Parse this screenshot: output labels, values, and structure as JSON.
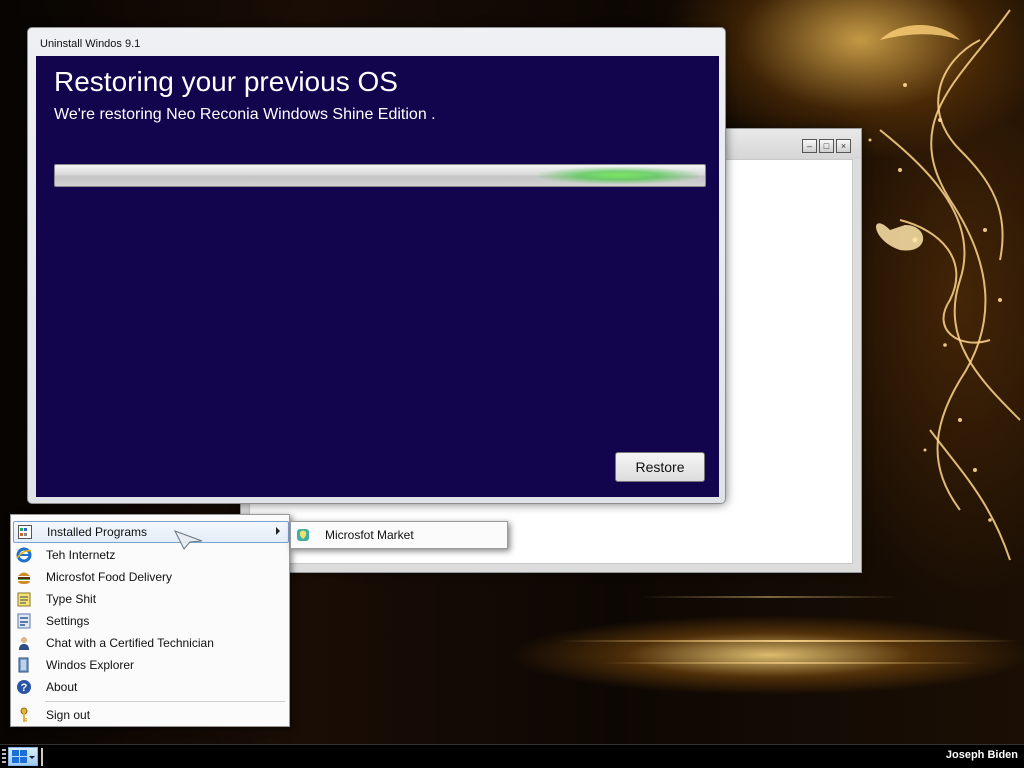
{
  "dialog": {
    "title": "Uninstall Windos 9.1",
    "heading": "Restoring your previous OS",
    "subheading": "We're restoring Neo Reconia Windows Shine Edition .",
    "restore_label": "Restore"
  },
  "back_window": {
    "buttons": [
      "minimize",
      "maximize",
      "close"
    ]
  },
  "start_menu": {
    "items": [
      {
        "label": "Installed Programs",
        "icon": "installed-programs-icon",
        "has_submenu": true
      },
      {
        "label": "Teh Internetz",
        "icon": "internet-explorer-icon"
      },
      {
        "label": "Microsfot Food Delivery",
        "icon": "burger-icon"
      },
      {
        "label": "Type Shit",
        "icon": "notepad-icon"
      },
      {
        "label": "Settings",
        "icon": "settings-icon"
      },
      {
        "label": "Chat with a Certified Technician",
        "icon": "technician-icon"
      },
      {
        "label": "Windos Explorer",
        "icon": "explorer-icon"
      },
      {
        "label": "About",
        "icon": "help-icon"
      },
      {
        "label": "Sign out",
        "icon": "key-icon"
      }
    ]
  },
  "submenu": {
    "items": [
      {
        "label": "Microsfot Market",
        "icon": "market-icon"
      }
    ]
  },
  "taskbar": {
    "user": "Joseph Biden"
  },
  "colors": {
    "dialog_bg": "#13044e",
    "progress_glow": "#5fd84a",
    "highlight_border": "#7da2ce"
  }
}
